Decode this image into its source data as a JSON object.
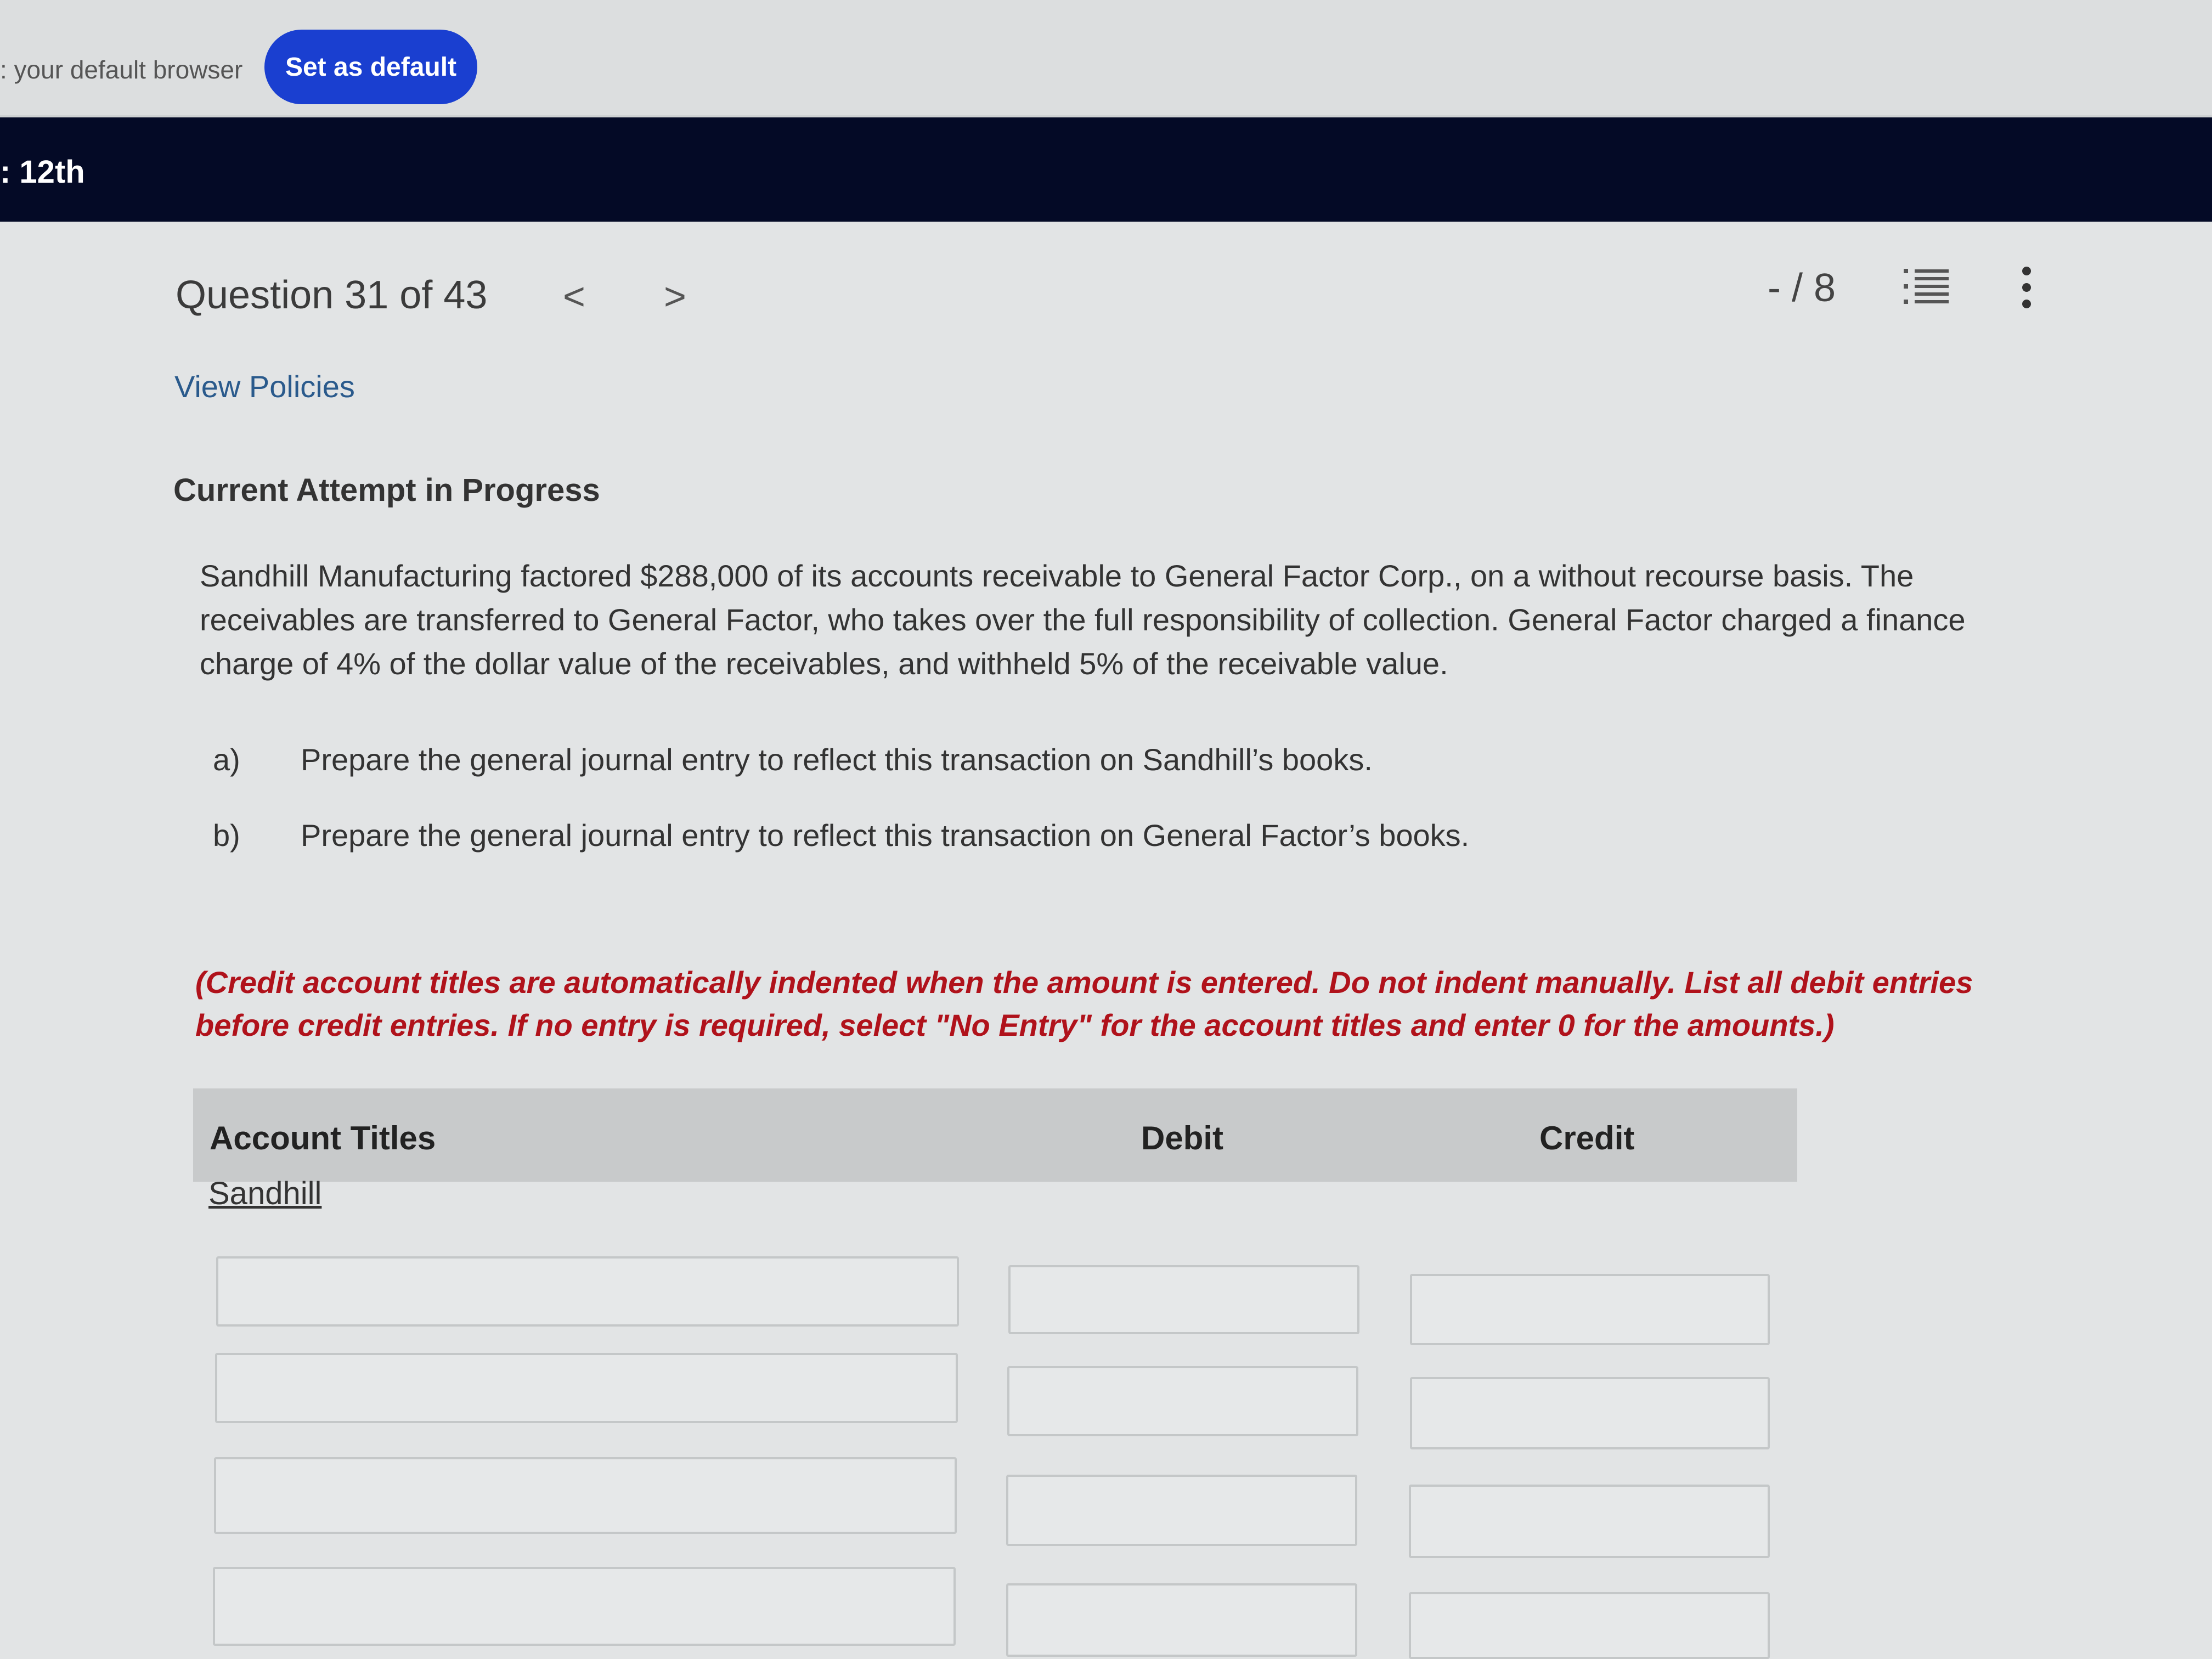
{
  "browser_bar": {
    "message": ": your default browser",
    "set_default_label": "Set as default"
  },
  "header": {
    "title": ": 12th"
  },
  "question": {
    "counter": "Question 31 of 43",
    "prev_icon": "<",
    "next_icon": ">",
    "score": "- / 8",
    "view_policies": "View Policies",
    "attempt_label": "Current Attempt in Progress",
    "problem_text": "Sandhill Manufacturing factored $288,000 of its accounts receivable to General Factor Corp., on a without recourse basis. The receivables are transferred to General Factor, who takes over the full responsibility of collection. General Factor charged a finance charge of 4% of the dollar value of the receivables, and withheld 5% of the receivable value.",
    "parts": [
      {
        "label": "a)",
        "text": "Prepare the general journal entry to reflect this transaction on Sandhill’s books."
      },
      {
        "label": "b)",
        "text": "Prepare the general journal entry to reflect this transaction on General Factor’s books."
      }
    ],
    "instructions": "(Credit account titles are automatically indented when the amount is entered. Do not indent manually. List all debit entries before credit entries. If no entry is required, select \"No Entry\" for the account titles and enter 0 for the amounts.)"
  },
  "journal_table": {
    "headers": [
      "Account Titles",
      "Debit",
      "Credit"
    ],
    "section_label": "Sandhill",
    "rows": [
      {
        "account": "",
        "debit": "",
        "credit": ""
      },
      {
        "account": "",
        "debit": "",
        "credit": ""
      },
      {
        "account": "",
        "debit": "",
        "credit": ""
      },
      {
        "account": "",
        "debit": "",
        "credit": ""
      }
    ]
  },
  "icons": {
    "list": "list-icon",
    "more": "kebab-menu-icon"
  },
  "colors": {
    "primary_button": "#1a3fd0",
    "header_bar": "#040a26",
    "instruction_text": "#b0121b",
    "link": "#2a5a8c"
  }
}
